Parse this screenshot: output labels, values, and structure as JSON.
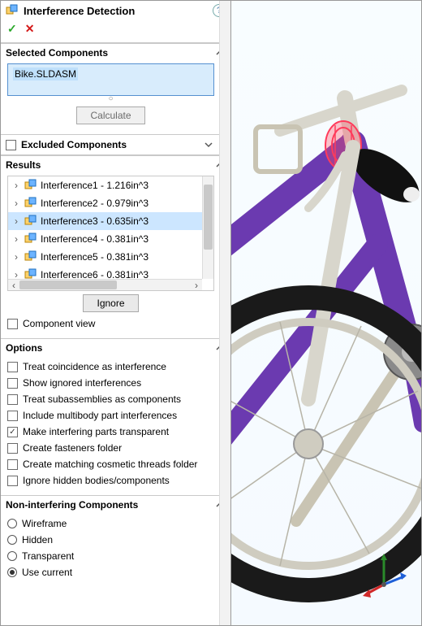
{
  "header": {
    "title": "Interference Detection",
    "help_tooltip": "Help"
  },
  "actions": {
    "ok_glyph": "✓",
    "cancel_glyph": "✕"
  },
  "sections": {
    "selected_label": "Selected Components",
    "excluded_label": "Excluded Components",
    "results_label": "Results",
    "options_label": "Options",
    "noninterfering_label": "Non-interfering Components"
  },
  "selected": {
    "value": "Bike.SLDASM",
    "calculate_label": "Calculate"
  },
  "results": {
    "ignore_label": "Ignore",
    "component_view_label": "Component view",
    "items": [
      {
        "label": "Interference1 - 1.216in^3",
        "selected": false
      },
      {
        "label": "Interference2 - 0.979in^3",
        "selected": false
      },
      {
        "label": "Interference3 - 0.635in^3",
        "selected": true
      },
      {
        "label": "Interference4 - 0.381in^3",
        "selected": false
      },
      {
        "label": "Interference5 - 0.381in^3",
        "selected": false
      },
      {
        "label": "Interference6 - 0.381in^3",
        "selected": false
      }
    ]
  },
  "options": [
    {
      "label": "Treat coincidence as interference",
      "checked": false
    },
    {
      "label": "Show ignored interferences",
      "checked": false
    },
    {
      "label": "Treat subassemblies as components",
      "checked": false
    },
    {
      "label": "Include multibody part interferences",
      "checked": false
    },
    {
      "label": "Make interfering parts transparent",
      "checked": true
    },
    {
      "label": "Create fasteners folder",
      "checked": false
    },
    {
      "label": "Create matching cosmetic threads folder",
      "checked": false
    },
    {
      "label": "Ignore hidden bodies/components",
      "checked": false
    }
  ],
  "noninterfering": [
    {
      "label": "Wireframe",
      "selected": false
    },
    {
      "label": "Hidden",
      "selected": false
    },
    {
      "label": "Transparent",
      "selected": false
    },
    {
      "label": "Use current",
      "selected": true
    }
  ],
  "viewport": {
    "model_name": "Bike",
    "highlighted_part": "Brake mount (interference region)"
  }
}
